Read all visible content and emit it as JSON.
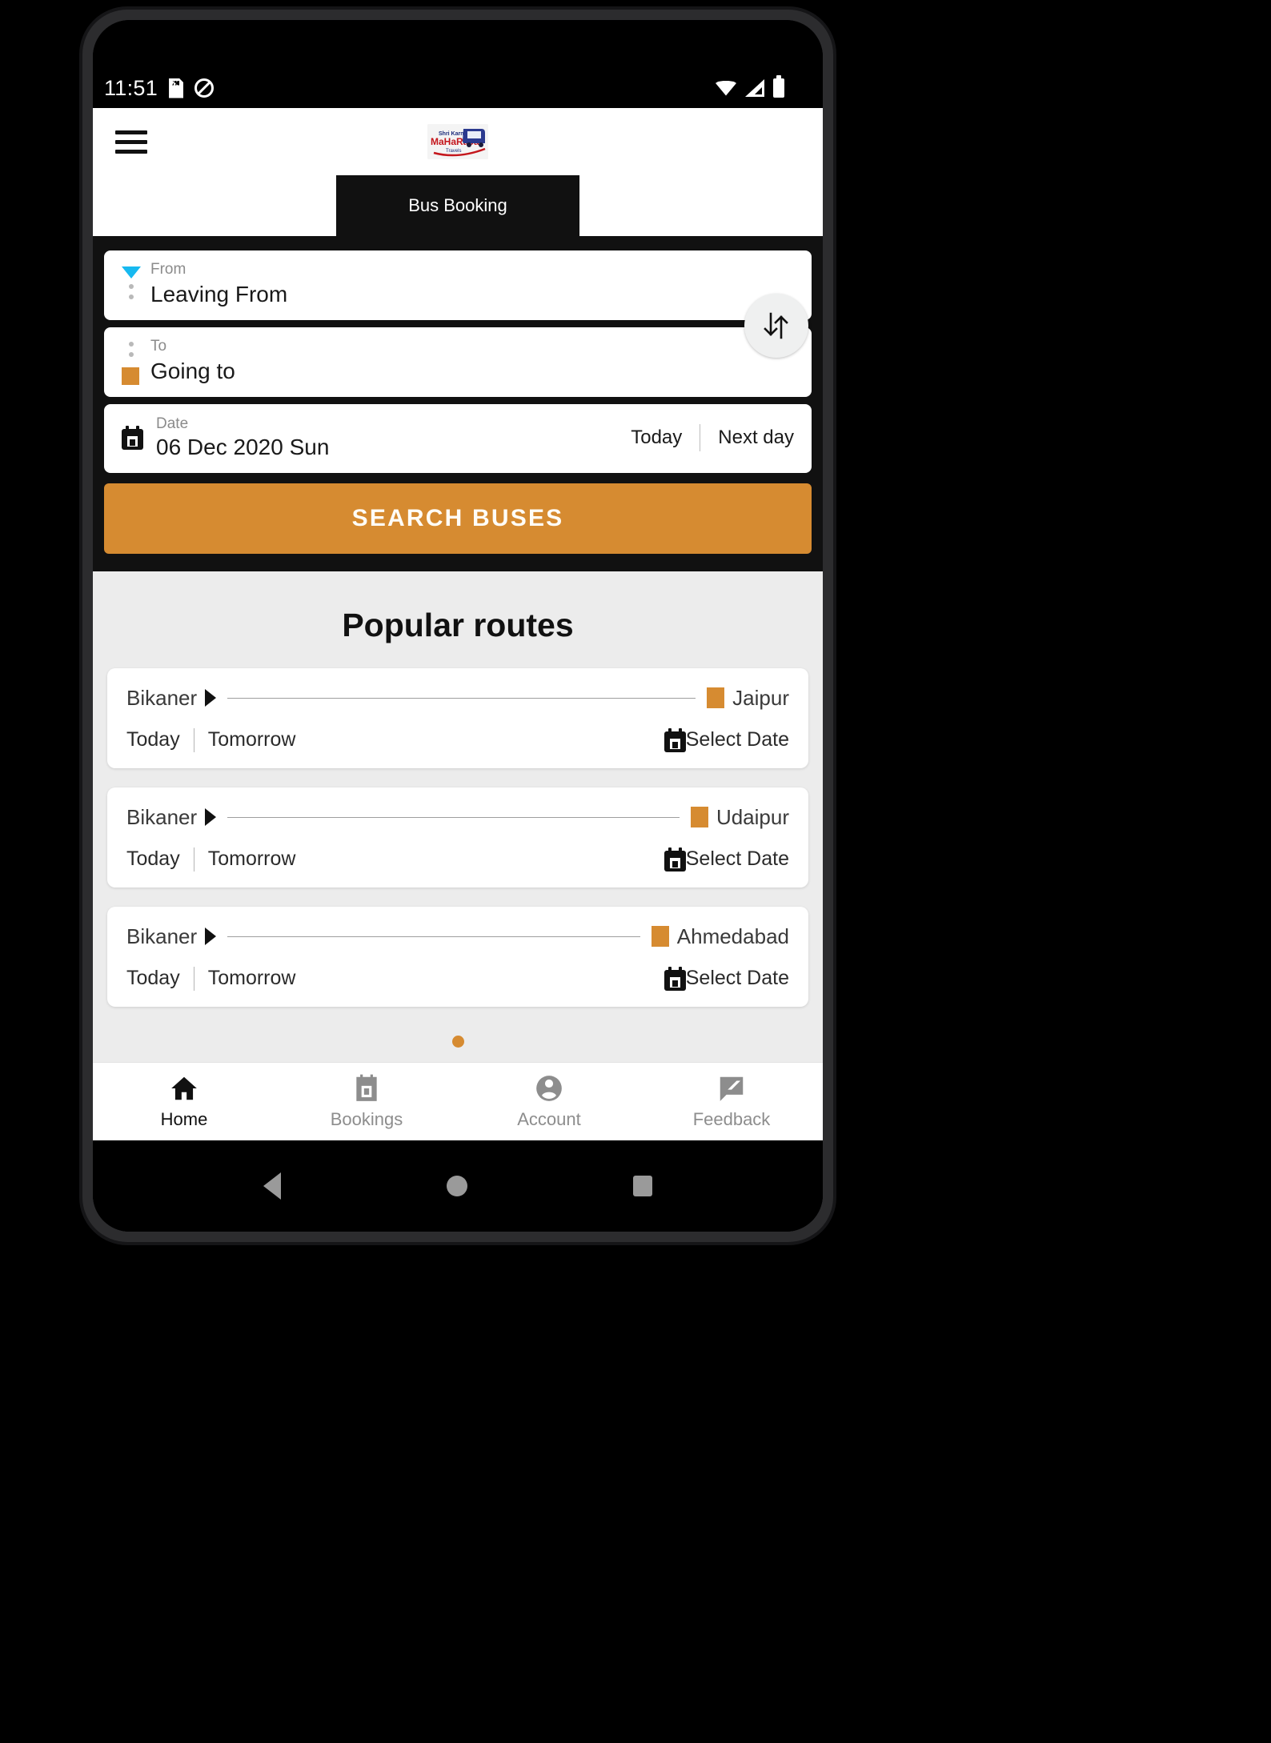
{
  "status_bar": {
    "time": "11:51",
    "icons_left": [
      "sd-card-icon",
      "do-not-disturb-icon"
    ],
    "icons_right": [
      "wifi-icon",
      "signal-icon",
      "battery-icon"
    ]
  },
  "app_bar": {
    "menu_icon": "hamburger-menu-icon",
    "logo_line1": "Shri Karni",
    "logo_line2": "MaHaRaJa",
    "logo_line3": "Travels"
  },
  "tabs": [
    {
      "label": "",
      "active": false
    },
    {
      "label": "Bus Booking",
      "active": true
    },
    {
      "label": "",
      "active": false
    }
  ],
  "search_form": {
    "from": {
      "label": "From",
      "value": "Leaving From"
    },
    "to": {
      "label": "To",
      "value": "Going to"
    },
    "swap_icon": "swap-vertical-icon",
    "date": {
      "label": "Date",
      "value": "06 Dec 2020 Sun",
      "today_label": "Today",
      "next_day_label": "Next day",
      "calendar_icon": "calendar-icon"
    },
    "search_button": "SEARCH BUSES"
  },
  "popular_routes": {
    "title": "Popular routes",
    "cards": [
      {
        "origin": "Bikaner",
        "destination": "Jaipur",
        "today_label": "Today",
        "tomorrow_label": "Tomorrow",
        "select_date_label": "Select Date"
      },
      {
        "origin": "Bikaner",
        "destination": "Udaipur",
        "today_label": "Today",
        "tomorrow_label": "Tomorrow",
        "select_date_label": "Select Date"
      },
      {
        "origin": "Bikaner",
        "destination": "Ahmedabad",
        "today_label": "Today",
        "tomorrow_label": "Tomorrow",
        "select_date_label": "Select Date"
      }
    ],
    "pager_dots": 1,
    "active_dot": 0
  },
  "bottom_nav": [
    {
      "label": "Home",
      "icon": "home-icon",
      "active": true
    },
    {
      "label": "Bookings",
      "icon": "calendar-icon",
      "active": false
    },
    {
      "label": "Account",
      "icon": "account-circle-icon",
      "active": false
    },
    {
      "label": "Feedback",
      "icon": "feedback-icon",
      "active": false
    }
  ],
  "android_nav": {
    "back": "back-triangle-icon",
    "home": "home-circle-icon",
    "recents": "recents-square-icon"
  },
  "colors": {
    "accent_orange": "#d68b31",
    "panel_black": "#111111",
    "from_marker_blue": "#17b9f0",
    "section_bg": "#ececec"
  }
}
